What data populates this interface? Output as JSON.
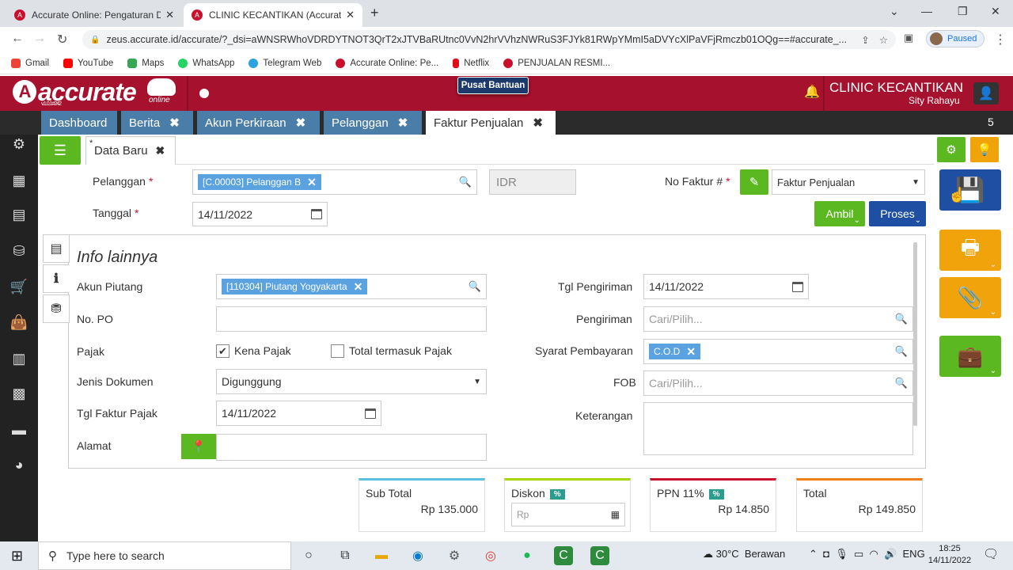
{
  "browser": {
    "tabs": [
      {
        "label": "Accurate Online: Pengaturan Dat",
        "fav": "A"
      },
      {
        "label": "CLINIC KECANTIKAN (Accurate O",
        "fav": "A"
      }
    ],
    "url": "zeus.accurate.id/accurate/?_dsi=aWNSRWhoVDRDYTNOT3QrT2xJTVBaRUtnc0VvN2hrVVhzNWRuS3FJYk81RWpYMmI5aDVYcXlPaVFjRmczb01OQg==#accurate_...",
    "profile_status": "Paused",
    "bookmarks": [
      {
        "label": "Gmail",
        "color": "#ea4335"
      },
      {
        "label": "YouTube",
        "color": "#ff0000"
      },
      {
        "label": "Maps",
        "color": "#34a853"
      },
      {
        "label": "WhatsApp",
        "color": "#25d366"
      },
      {
        "label": "Telegram Web",
        "color": "#2aa3df"
      },
      {
        "label": "Accurate Online: Pe...",
        "color": "#c8102e"
      },
      {
        "label": "Netflix",
        "color": "#e50914"
      },
      {
        "label": "PENJUALAN RESMI...",
        "color": "#c8102e"
      }
    ]
  },
  "app": {
    "logo_text": "accurate",
    "logo_mark": "A",
    "version": "v.1.0.1#242",
    "online_label": "online",
    "help_label": "Pusat Bantuan",
    "company": "CLINIC KECANTIKAN",
    "user": "Sity Rahayu",
    "tabs": [
      {
        "label": "Dashboard"
      },
      {
        "label": "Berita"
      },
      {
        "label": "Akun Perkiraan"
      },
      {
        "label": "Pelanggan"
      },
      {
        "label": "Faktur Penjualan"
      }
    ],
    "tab_count": "5"
  },
  "form": {
    "subtab_label": "Data Baru",
    "subtab_marker": "*",
    "pelanggan_label": "Pelanggan",
    "pelanggan_value": "[C.00003] Pelanggan B",
    "currency": "IDR",
    "tanggal_label": "Tanggal",
    "tanggal_value": "14/11/2022",
    "no_faktur_label": "No Faktur #",
    "no_faktur_value": "Faktur Penjualan",
    "ambil_label": "Ambil",
    "proses_label": "Proses",
    "required_mark": "*"
  },
  "info": {
    "title": "Info lainnya",
    "akun_piutang_label": "Akun Piutang",
    "akun_piutang_value": "[110304] Piutang Yogyakarta",
    "no_po_label": "No. PO",
    "pajak_label": "Pajak",
    "kena_pajak_label": "Kena Pajak",
    "kena_pajak_checked": true,
    "total_termasuk_label": "Total termasuk Pajak",
    "total_termasuk_checked": false,
    "jenis_dokumen_label": "Jenis Dokumen",
    "jenis_dokumen_value": "Digunggung",
    "tgl_faktur_pajak_label": "Tgl Faktur Pajak",
    "tgl_faktur_pajak_value": "14/11/2022",
    "alamat_label": "Alamat",
    "tgl_pengiriman_label": "Tgl Pengiriman",
    "tgl_pengiriman_value": "14/11/2022",
    "pengiriman_label": "Pengiriman",
    "pengiriman_placeholder": "Cari/Pilih...",
    "syarat_label": "Syarat Pembayaran",
    "syarat_value": "C.O.D",
    "fob_label": "FOB",
    "fob_placeholder": "Cari/Pilih...",
    "keterangan_label": "Keterangan"
  },
  "totals": {
    "subtotal_label": "Sub Total",
    "subtotal_value": "Rp 135.000",
    "diskon_label": "Diskon",
    "diskon_badge": "%",
    "diskon_placeholder": "Rp",
    "ppn_label": "PPN 11%",
    "ppn_badge": "%",
    "ppn_value": "Rp 14.850",
    "total_label": "Total",
    "total_value": "Rp 149.850",
    "colors": {
      "subtotal": "#5bc0de",
      "diskon": "#a6d608",
      "ppn": "#c8102e",
      "total": "#f07f1a"
    }
  },
  "taskbar": {
    "search_placeholder": "Type here to search",
    "temperature": "30°C",
    "weather": "Berawan",
    "language": "ENG",
    "time": "18:25",
    "date": "14/11/2022"
  },
  "colors": {
    "brand": "#a6112e",
    "green": "#5cb821",
    "blue": "#1e4fa3",
    "orange": "#f0a30a",
    "tab_blue": "#4a7ea8"
  }
}
